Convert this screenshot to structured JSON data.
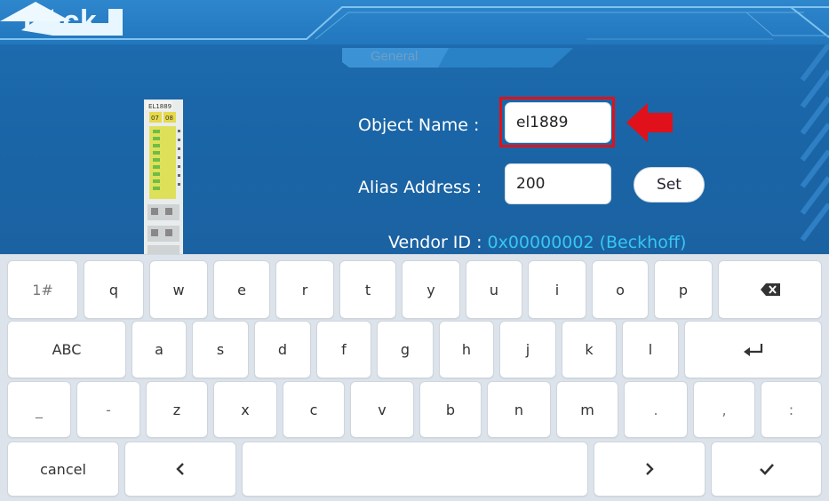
{
  "header": {
    "back_label": "Back",
    "tab_label": "General"
  },
  "form": {
    "object_name_label": "Object Name :",
    "object_name_value": "el1889",
    "alias_label": "Alias Address :",
    "alias_value": "200",
    "set_label": "Set",
    "vendor_label": "Vendor ID :",
    "vendor_value": "0x00000002 (Beckhoff)"
  },
  "device": {
    "model_label": "EL1889",
    "led_left": "07",
    "led_right": "08"
  },
  "keyboard": {
    "row1": [
      "1#",
      "q",
      "w",
      "e",
      "r",
      "t",
      "y",
      "u",
      "i",
      "o",
      "p"
    ],
    "row2": [
      "ABC",
      "a",
      "s",
      "d",
      "f",
      "g",
      "h",
      "j",
      "k",
      "l"
    ],
    "row3": [
      "_",
      "-",
      "z",
      "x",
      "c",
      "v",
      "b",
      "n",
      "m",
      ".",
      ",",
      ":"
    ],
    "row4_cancel": "cancel",
    "icons": {
      "backspace": "backspace-icon",
      "enter": "enter-icon",
      "left": "chevron-left-icon",
      "right": "chevron-right-icon",
      "confirm": "checkmark-icon"
    }
  },
  "colors": {
    "background": "#1a66a8",
    "highlight": "#e0111a",
    "vendor_value": "#36c7f2"
  }
}
